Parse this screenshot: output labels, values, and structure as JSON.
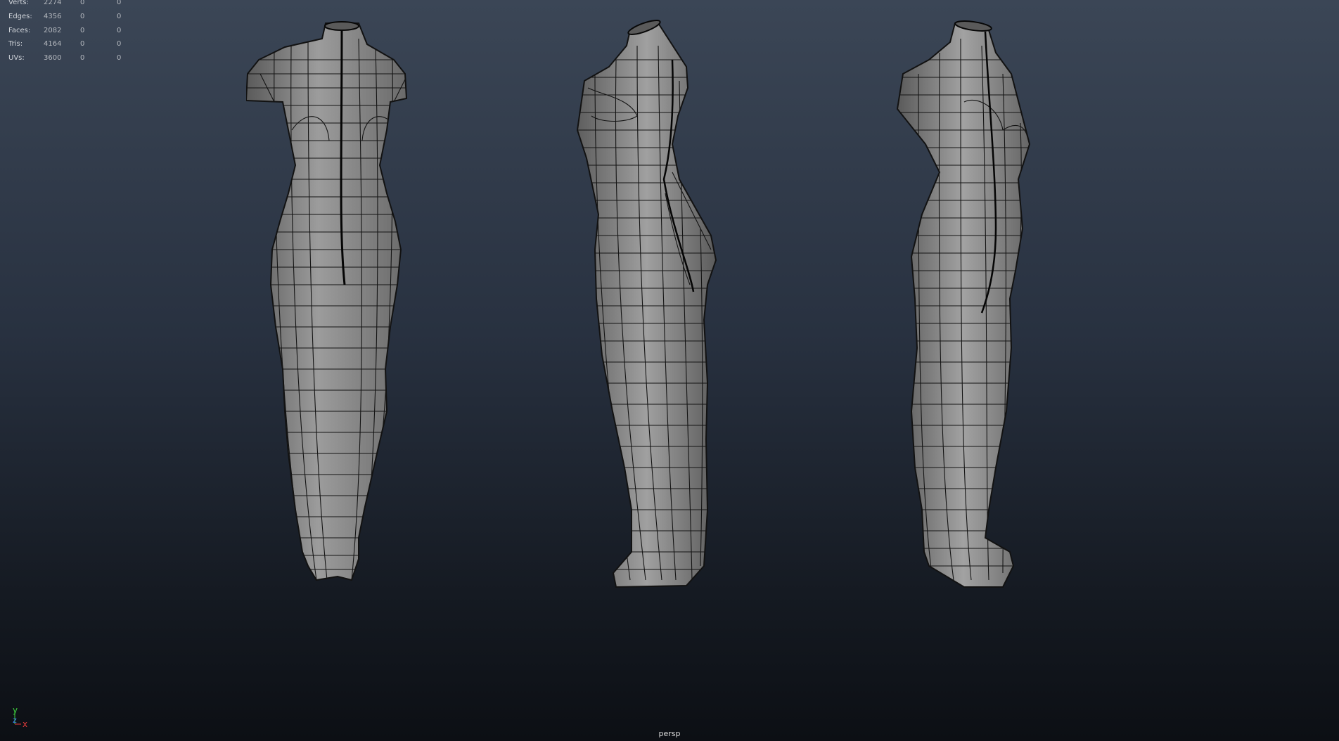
{
  "viewport": {
    "camera_name": "persp",
    "background_top": "#3b4656",
    "background_bottom": "#0c0f14",
    "mesh_color": "#8f8f8f",
    "wire_color": "#121212"
  },
  "heads_up": {
    "rows": [
      {
        "label": "Verts:",
        "value": "2274",
        "selected": "0",
        "tri_selected": "0"
      },
      {
        "label": "Edges:",
        "value": "4356",
        "selected": "0",
        "tri_selected": "0"
      },
      {
        "label": "Faces:",
        "value": "2082",
        "selected": "0",
        "tri_selected": "0"
      },
      {
        "label": "Tris:",
        "value": "4164",
        "selected": "0",
        "tri_selected": "0"
      },
      {
        "label": "UVs:",
        "value": "3600",
        "selected": "0",
        "tri_selected": "0"
      }
    ]
  },
  "axis": {
    "y_label": "y",
    "z_label": "z",
    "x_label": "x",
    "y_color": "#3fd13f",
    "z_color": "#3f7fff",
    "x_color": "#e23a3a"
  },
  "models": [
    {
      "view": "front-view-torso-model"
    },
    {
      "view": "side-view-torso-model"
    },
    {
      "view": "three-quarter-view-torso-model"
    }
  ]
}
